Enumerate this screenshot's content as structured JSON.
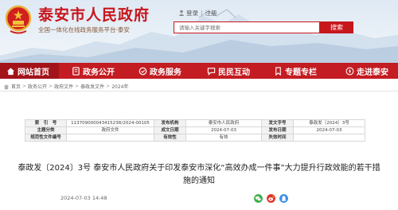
{
  "header": {
    "site_title": "泰安市人民政府",
    "site_subtitle": "全国一体化在线政务服务平台·泰安",
    "login_label": "登录",
    "register_label": "注册",
    "separator": "|",
    "search_placeholder": "请输入关键字搜索",
    "search_button": "搜索"
  },
  "nav": {
    "items": [
      {
        "label": "网站首页",
        "icon": "home-icon"
      },
      {
        "label": "政务公开",
        "icon": "document-icon"
      },
      {
        "label": "政务服务",
        "icon": "service-icon"
      },
      {
        "label": "民民互动",
        "icon": "chat-icon"
      },
      {
        "label": "专题专栏",
        "icon": "bookmark-icon"
      },
      {
        "label": "走进泰安",
        "icon": "compass-icon"
      }
    ],
    "active_color": "#a3141a",
    "bar_color": "#c31c22"
  },
  "breadcrumb": {
    "items": [
      "首页",
      "政务公开",
      "政府文件",
      "泰政发文件",
      "2024年"
    ],
    "separator": ">"
  },
  "meta": {
    "rows": [
      [
        {
          "k": "索　引　号",
          "v": "11370900004341523R/2024-00105"
        },
        {
          "k": "发布机构",
          "v": "泰安市人民政府"
        },
        {
          "k": "发文字号",
          "v": "泰政发〔2024〕3号"
        }
      ],
      [
        {
          "k": "主题分类",
          "v": "政府文件"
        },
        {
          "k": "成文日期",
          "v": "2024-07-03"
        },
        {
          "k": "发布日期",
          "v": "2024-07-03"
        }
      ],
      [
        {
          "k": "规范性文件编号",
          "v": ""
        },
        {
          "k": "有效性",
          "v": "有效"
        },
        {
          "k": "失效时间",
          "v": ""
        }
      ]
    ]
  },
  "article": {
    "title": "泰政发〔2024〕3号 泰安市人民政府关于印发泰安市深化“高效办成一件事”大力提升行政效能的若干措施的通知",
    "publish_date": "2024-07-03 14:48"
  },
  "share": {
    "icons": [
      {
        "name": "wechat-share-icon",
        "color": "#3fae49"
      },
      {
        "name": "weibo-share-icon",
        "color": "#e0332a"
      },
      {
        "name": "qq-share-icon",
        "color": "#3a8ee6"
      }
    ]
  },
  "colors": {
    "brand_red": "#c8161d"
  }
}
